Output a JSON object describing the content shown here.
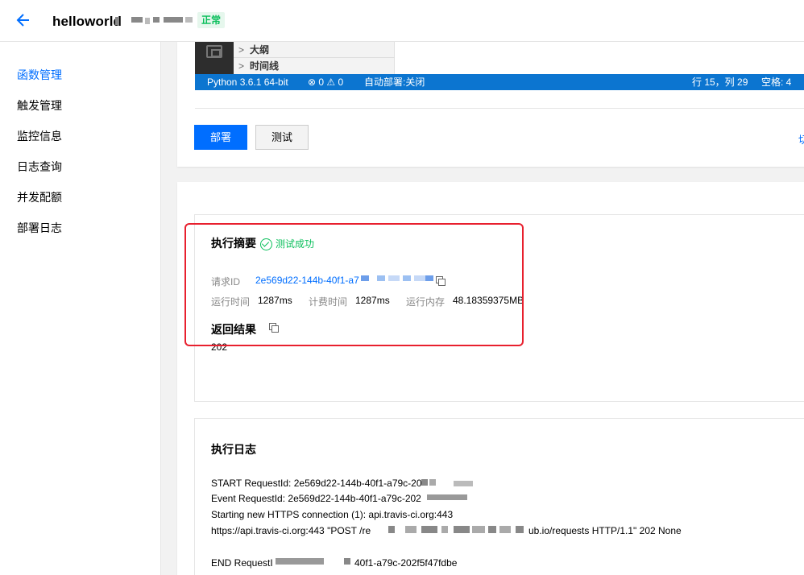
{
  "header": {
    "title": "helloworld",
    "status": "正常"
  },
  "sidebar": {
    "items": [
      {
        "label": "函数管理"
      },
      {
        "label": "触发管理"
      },
      {
        "label": "监控信息"
      },
      {
        "label": "日志查询"
      },
      {
        "label": "并发配额"
      },
      {
        "label": "部署日志"
      }
    ]
  },
  "editor": {
    "outline": [
      "大纲",
      "时间线"
    ],
    "statusbar": {
      "python": "Python 3.6.1 64-bit",
      "problems": "⊗ 0 ⚠ 0",
      "autodeploy": "自动部署:关闭",
      "position": "行 15，列 29",
      "spaces": "空格: 4"
    },
    "deploy_label": "部署",
    "test_label": "测试",
    "edge_link": "切"
  },
  "summary": {
    "title": "执行摘要",
    "success": "测试成功",
    "request_id_label": "请求ID",
    "request_id": "2e569d22-144b-40f1-a7",
    "run_time_label": "运行时间",
    "run_time": "1287ms",
    "bill_time_label": "计费时间",
    "bill_time": "1287ms",
    "memory_label": "运行内存",
    "memory": "48.18359375MB",
    "result_title": "返回结果",
    "result_value": "202"
  },
  "log": {
    "title": "执行日志",
    "lines": [
      "START RequestId: 2e569d22-144b-40f1-a79c-20",
      "Event RequestId: 2e569d22-144b-40f1-a79c-202",
      "Starting new HTTPS connection (1): api.travis-ci.org:443",
      "https://api.travis-ci.org:443 \"POST /re",
      "ub.io/requests HTTP/1.1\" 202 None",
      "END RequestI",
      "40f1-a79c-202f5f47fdbe"
    ]
  },
  "colors": {
    "accent": "#006eff",
    "success": "#0abf5b",
    "highlight": "#e8202e",
    "statusbar": "#0c75d0"
  }
}
